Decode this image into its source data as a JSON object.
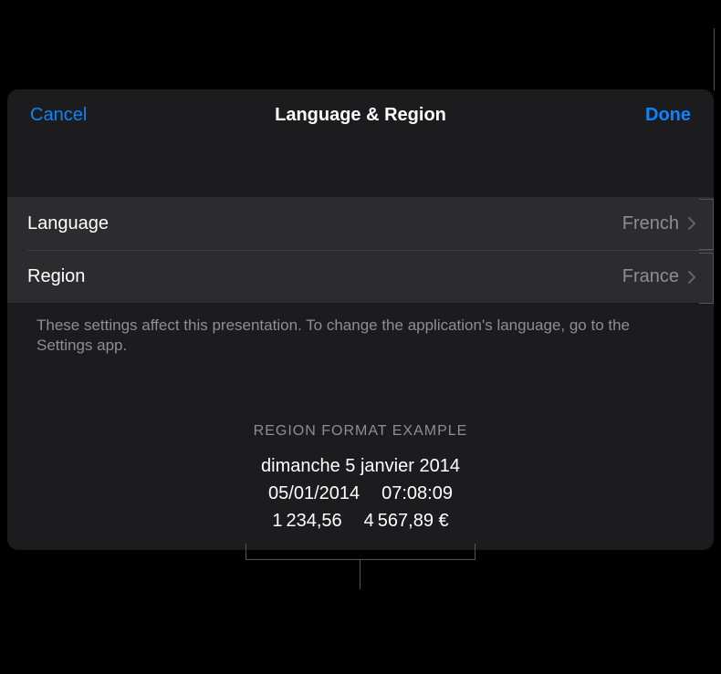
{
  "header": {
    "cancel": "Cancel",
    "title": "Language & Region",
    "done": "Done"
  },
  "rows": {
    "language": {
      "label": "Language",
      "value": "French"
    },
    "region": {
      "label": "Region",
      "value": "France"
    }
  },
  "note": "These settings affect this presentation. To change the application's language, go to the Settings app.",
  "example": {
    "header": "REGION FORMAT EXAMPLE",
    "longDate": "dimanche 5 janvier 2014",
    "shortDate": "05/01/2014",
    "time": "07:08:09",
    "number": "1 234,56",
    "currency": "4 567,89 €"
  }
}
